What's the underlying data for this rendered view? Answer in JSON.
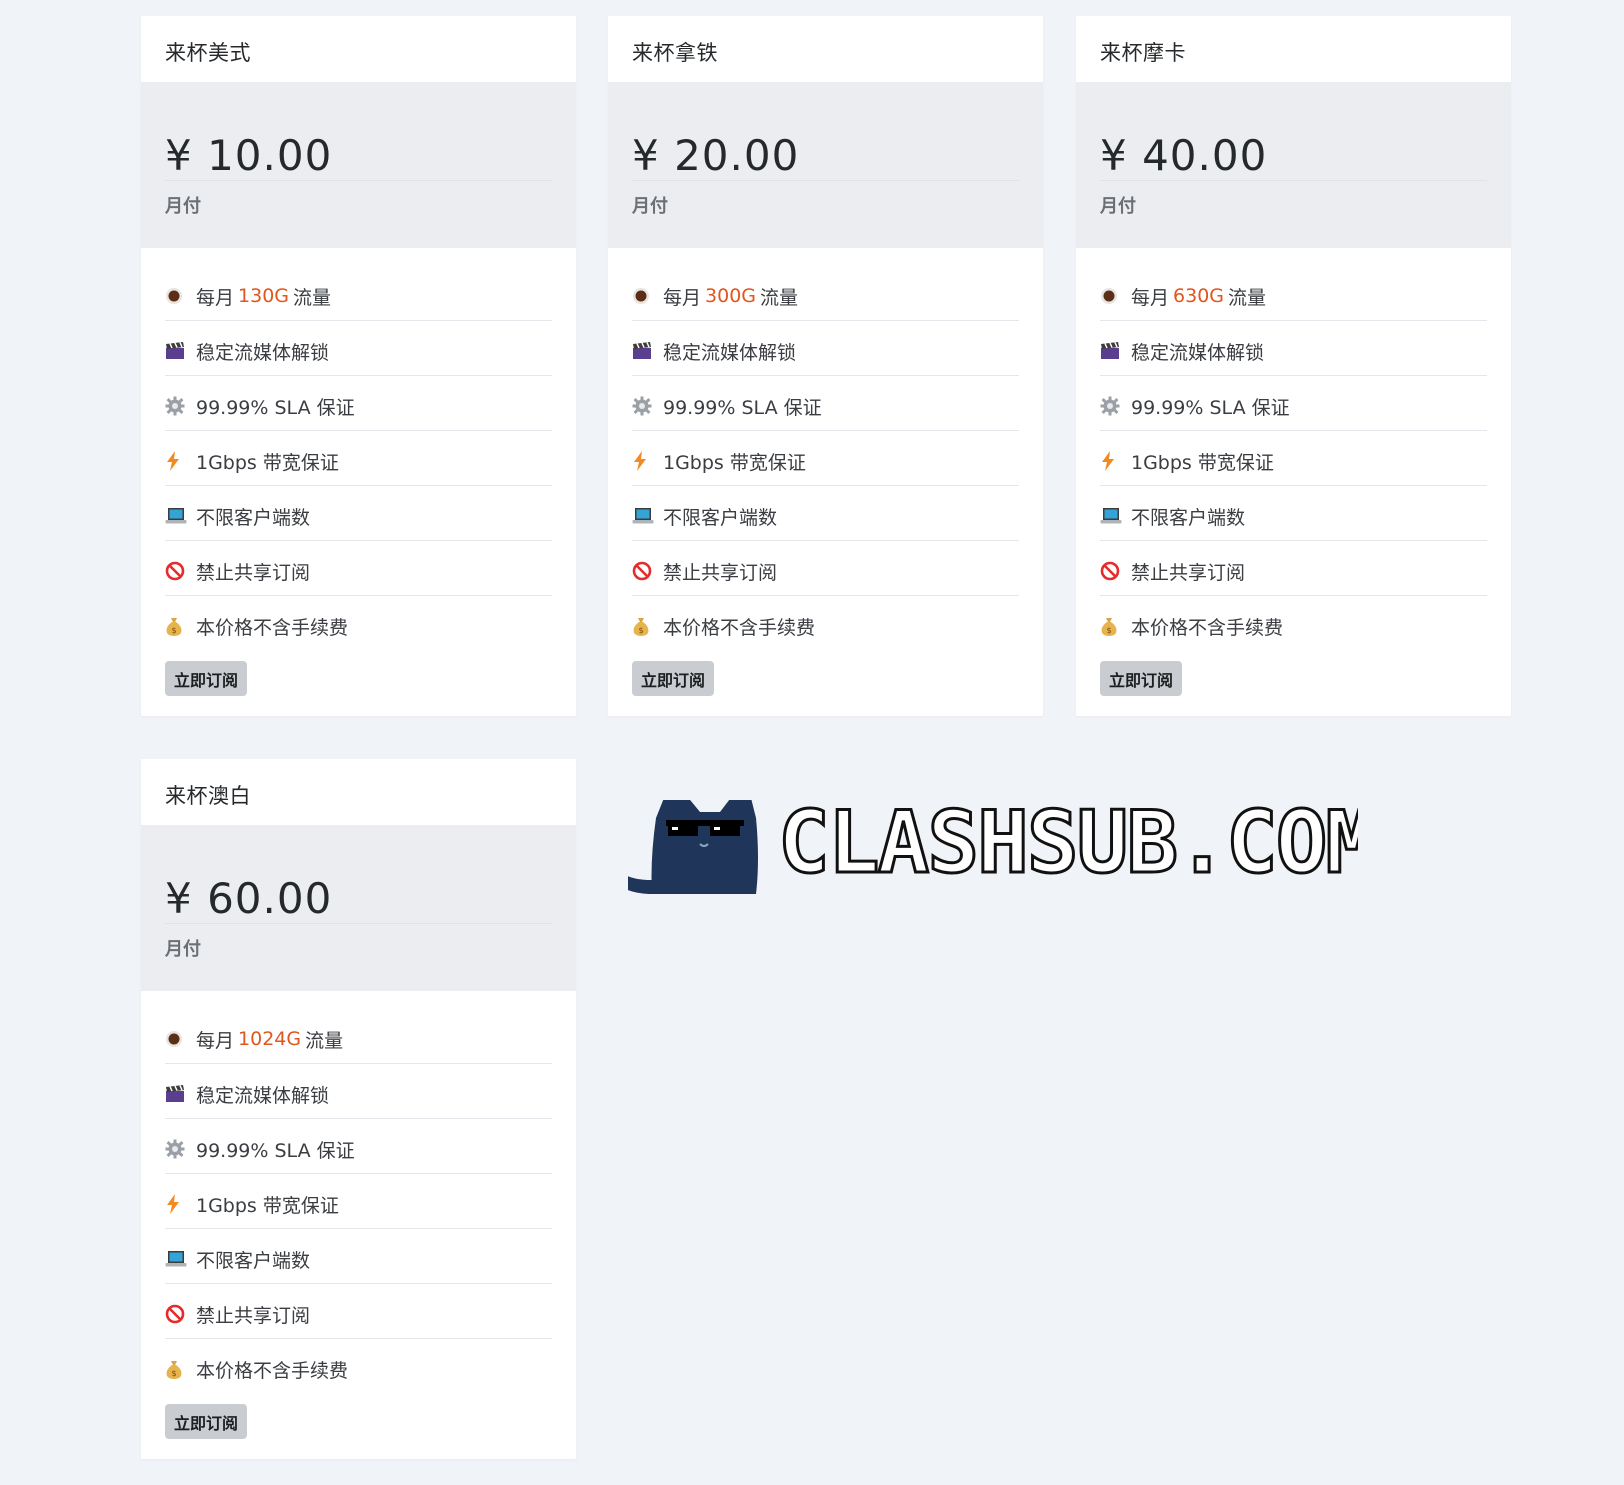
{
  "plans": [
    {
      "title": "来杯美式",
      "price": "¥ 10.00",
      "period": "月付",
      "traffic_prefix": "每月",
      "traffic_amount": "130G",
      "traffic_suffix": "流量",
      "features": [
        "稳定流媒体解锁",
        "99.99% SLA 保证",
        "1Gbps 带宽保证",
        "不限客户端数",
        "禁止共享订阅",
        "本价格不含手续费"
      ],
      "button": "立即订阅"
    },
    {
      "title": "来杯拿铁",
      "price": "¥ 20.00",
      "period": "月付",
      "traffic_prefix": "每月",
      "traffic_amount": "300G",
      "traffic_suffix": "流量",
      "features": [
        "稳定流媒体解锁",
        "99.99% SLA 保证",
        "1Gbps 带宽保证",
        "不限客户端数",
        "禁止共享订阅",
        "本价格不含手续费"
      ],
      "button": "立即订阅"
    },
    {
      "title": "来杯摩卡",
      "price": "¥ 40.00",
      "period": "月付",
      "traffic_prefix": "每月",
      "traffic_amount": "630G",
      "traffic_suffix": "流量",
      "features": [
        "稳定流媒体解锁",
        "99.99% SLA 保证",
        "1Gbps 带宽保证",
        "不限客户端数",
        "禁止共享订阅",
        "本价格不含手续费"
      ],
      "button": "立即订阅"
    },
    {
      "title": "来杯澳白",
      "price": "¥ 60.00",
      "period": "月付",
      "traffic_prefix": "每月",
      "traffic_amount": "1024G",
      "traffic_suffix": "流量",
      "features": [
        "稳定流媒体解锁",
        "99.99% SLA 保证",
        "1Gbps 带宽保证",
        "不限客户端数",
        "禁止共享订阅",
        "本价格不含手续费"
      ],
      "button": "立即订阅"
    }
  ],
  "feature_icons": [
    "coffee-icon",
    "clapperboard-icon",
    "gear-icon",
    "lightning-icon",
    "laptop-icon",
    "prohibited-icon",
    "money-bag-icon"
  ],
  "logo": {
    "text": "CLASHSUB.COM"
  },
  "colors": {
    "background": "#f0f3f7",
    "highlight": "#e0561f",
    "price_bg": "#ebedf0",
    "button_bg": "#c9ccd0",
    "logo_cat": "#1f3559"
  }
}
